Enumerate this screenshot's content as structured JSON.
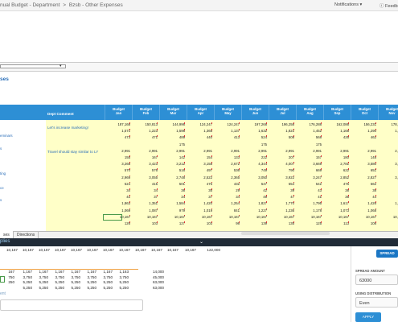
{
  "breadcrumb": {
    "part1": "nual Budget - Department",
    "sep": ">",
    "part2": "Bzsb - Other Expenses"
  },
  "topbar": {
    "notifications": "Notifications",
    "notif_arrow": "▾",
    "feedback": "Feedb"
  },
  "section_title": "ses",
  "grid": {
    "comment_header": "Dept Comment",
    "columns": [
      {
        "l1": "Budget",
        "l2": "Jan"
      },
      {
        "l1": "Budget",
        "l2": "Feb"
      },
      {
        "l1": "Budget",
        "l2": "Mar"
      },
      {
        "l1": "Budget",
        "l2": "Apr"
      },
      {
        "l1": "Budget",
        "l2": "May"
      },
      {
        "l1": "Budget",
        "l2": "Jun"
      },
      {
        "l1": "Budget",
        "l2": "Jul"
      },
      {
        "l1": "Budget",
        "l2": "Aug"
      },
      {
        "l1": "Budget",
        "l2": "Sep"
      },
      {
        "l1": "Budget",
        "l2": "Oct"
      },
      {
        "l1": "Budget",
        "l2": "Nov"
      }
    ],
    "side_labels": [
      "eminars",
      "s",
      "ting",
      "ce",
      "s"
    ],
    "comments": [
      "Let's increase marketing!",
      "Travel should stay similar to LY"
    ],
    "rows": [
      [
        "187,168",
        "150,813",
        "144,996",
        "124,247",
        "124,247",
        "197,268",
        "196,258",
        "176,288",
        "162,086",
        "156,231",
        "178,532"
      ],
      [
        "1,571",
        "1,223",
        "1,598",
        "1,368",
        "1,137",
        "1,632",
        "1,821",
        "1,452",
        "1,168",
        "1,290",
        "1,479"
      ],
      [
        "473",
        "471",
        "489",
        "440",
        "413",
        "524",
        "508",
        "568",
        "425",
        "462",
        "596"
      ],
      [
        "",
        "",
        "175",
        "",
        "",
        "175",
        "",
        "175",
        "",
        "",
        "175"
      ],
      [
        "2,991",
        "2,991",
        "2,991",
        "2,991",
        "2,991",
        "2,991",
        "2,991",
        "2,991",
        "2,991",
        "2,991",
        "2,991"
      ],
      [
        "155",
        "167",
        "142",
        "154",
        "133",
        "222",
        "207",
        "157",
        "180",
        "148",
        "191"
      ],
      [
        "3,268",
        "3,423",
        "3,212",
        "3,158",
        "2,672",
        "4,344",
        "4,007",
        "3,669",
        "2,781",
        "3,580",
        "3,561"
      ],
      [
        "570",
        "576",
        "516",
        "497",
        "536",
        "749",
        "790",
        "669",
        "622",
        "651",
        "637"
      ],
      [
        "2,969",
        "3,055",
        "2,748",
        "2,522",
        "2,365",
        "3,050",
        "3,922",
        "3,247",
        "2,852",
        "2,827",
        "3,398"
      ],
      [
        "524",
        "415",
        "501",
        "476",
        "432",
        "547",
        "554",
        "542",
        "476",
        "562",
        "519"
      ],
      [
        "34",
        "34",
        "38",
        "35",
        "29",
        "42",
        "39",
        "43",
        "38",
        "38",
        "48"
      ],
      [
        "41",
        "37",
        "34",
        "37",
        "34",
        "49",
        "47",
        "41",
        "36",
        "44",
        "47"
      ],
      [
        "1,863",
        "1,351",
        "1,584",
        "1,420",
        "1,254",
        "1,827",
        "1,770",
        "1,795",
        "1,617",
        "1,426",
        "1,747"
      ],
      [
        "1,069",
        "1,087",
        "979",
        "1,019",
        "841",
        "1,227",
        "1,236",
        "1,178",
        "1,073",
        "1,068",
        "944"
      ],
      [
        "10,167",
        "10,167",
        "10,167",
        "10,167",
        "10,167",
        "10,167",
        "10,167",
        "10,167",
        "10,167",
        "10,167",
        "10,167"
      ],
      [
        "126",
        "103",
        "127",
        "103",
        "98",
        "139",
        "135",
        "125",
        "113",
        "108",
        "129"
      ]
    ]
  },
  "sheet_tabs": [
    "ses",
    "Directions"
  ],
  "bottom_panel": {
    "title": "plies",
    "top_row": [
      "10,167",
      "10,167",
      "10,167",
      "10,167",
      "10,167",
      "10,167",
      "10,167",
      "10,167",
      "10,167",
      "10,167",
      "10,167",
      "10,167",
      "122,000"
    ],
    "rows": [
      [
        "167",
        "1,167",
        "1,167",
        "1,167",
        "1,167",
        "1,167",
        "1,167",
        "1,163",
        "14,000"
      ],
      [
        "750",
        "3,750",
        "3,750",
        "3,750",
        "3,750",
        "3,750",
        "3,750",
        "3,750",
        "45,000"
      ],
      [
        "250",
        "5,250",
        "5,250",
        "5,250",
        "5,250",
        "5,250",
        "5,250",
        "5,250",
        "63,000"
      ],
      [
        "",
        "5,250",
        "5,250",
        "5,250",
        "5,250",
        "5,250",
        "5,250",
        "5,250",
        "63,000"
      ]
    ],
    "comment_label": "ent"
  },
  "spread": {
    "button": "SPREAD",
    "amount_label": "SPREAD AMOUNT",
    "amount_value": "63000",
    "dist_label": "USING DISTRIBUTION",
    "dist_value": "Even",
    "apply": "APPLY"
  }
}
